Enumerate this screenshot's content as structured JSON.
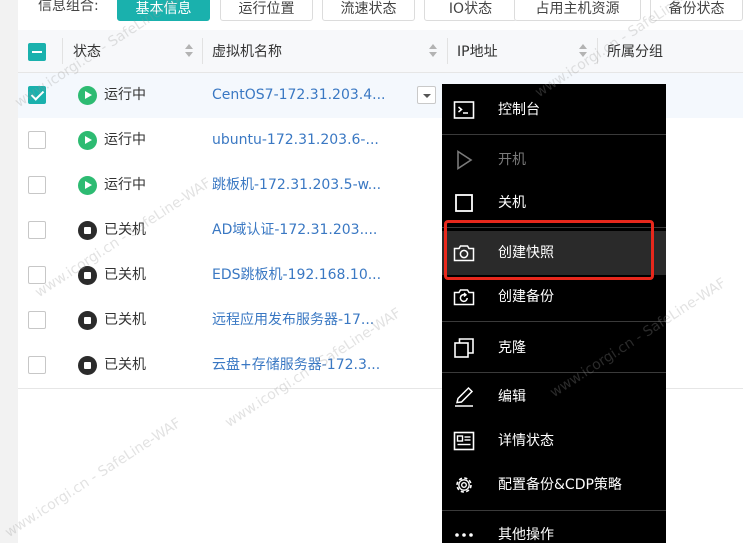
{
  "filter_bar": {
    "label": "信息组合:",
    "buttons": [
      "基本信息",
      "运行位置",
      "流速状态",
      "IO状态",
      "占用主机资源",
      "备份状态"
    ],
    "active_button": "基本信息"
  },
  "table": {
    "columns": [
      "状态",
      "虚拟机名称",
      "IP地址",
      "所属分组"
    ],
    "rows": [
      {
        "checked": true,
        "status": "运行中",
        "status_kind": "running",
        "name": "CentOS7-172.31.203.4..."
      },
      {
        "checked": false,
        "status": "运行中",
        "status_kind": "running",
        "name": "ubuntu-172.31.203.6-..."
      },
      {
        "checked": false,
        "status": "运行中",
        "status_kind": "running",
        "name": "跳板机-172.31.203.5-w..."
      },
      {
        "checked": false,
        "status": "已关机",
        "status_kind": "stopped",
        "name": "AD域认证-172.31.203...."
      },
      {
        "checked": false,
        "status": "已关机",
        "status_kind": "stopped",
        "name": "EDS跳板机-192.168.10..."
      },
      {
        "checked": false,
        "status": "已关机",
        "status_kind": "stopped",
        "name": "远程应用发布服务器-17..."
      },
      {
        "checked": false,
        "status": "已关机",
        "status_kind": "stopped",
        "name": "云盘+存储服务器-172.3..."
      }
    ]
  },
  "context_menu": {
    "items": [
      {
        "label": "控制台",
        "icon": "console-icon",
        "disabled": false
      },
      {
        "label": "开机",
        "icon": "play-icon",
        "disabled": true
      },
      {
        "label": "关机",
        "icon": "stop-icon",
        "disabled": false
      },
      {
        "label": "创建快照",
        "icon": "camera-icon",
        "disabled": false,
        "hover": true
      },
      {
        "label": "创建备份",
        "icon": "backup-icon",
        "disabled": false
      },
      {
        "label": "克隆",
        "icon": "clone-icon",
        "disabled": false
      },
      {
        "label": "编辑",
        "icon": "edit-icon",
        "disabled": false
      },
      {
        "label": "详情状态",
        "icon": "detail-icon",
        "disabled": false
      },
      {
        "label": "配置备份&CDP策略",
        "icon": "gear-icon",
        "disabled": false
      },
      {
        "label": "其他操作",
        "icon": "more-icon",
        "disabled": false
      }
    ]
  },
  "watermark": "www.icorgi.cn - SafeLine-WAF",
  "colors": {
    "accent": "#1ab1ad",
    "running": "#2dbb72",
    "highlight": "#e8281c"
  }
}
